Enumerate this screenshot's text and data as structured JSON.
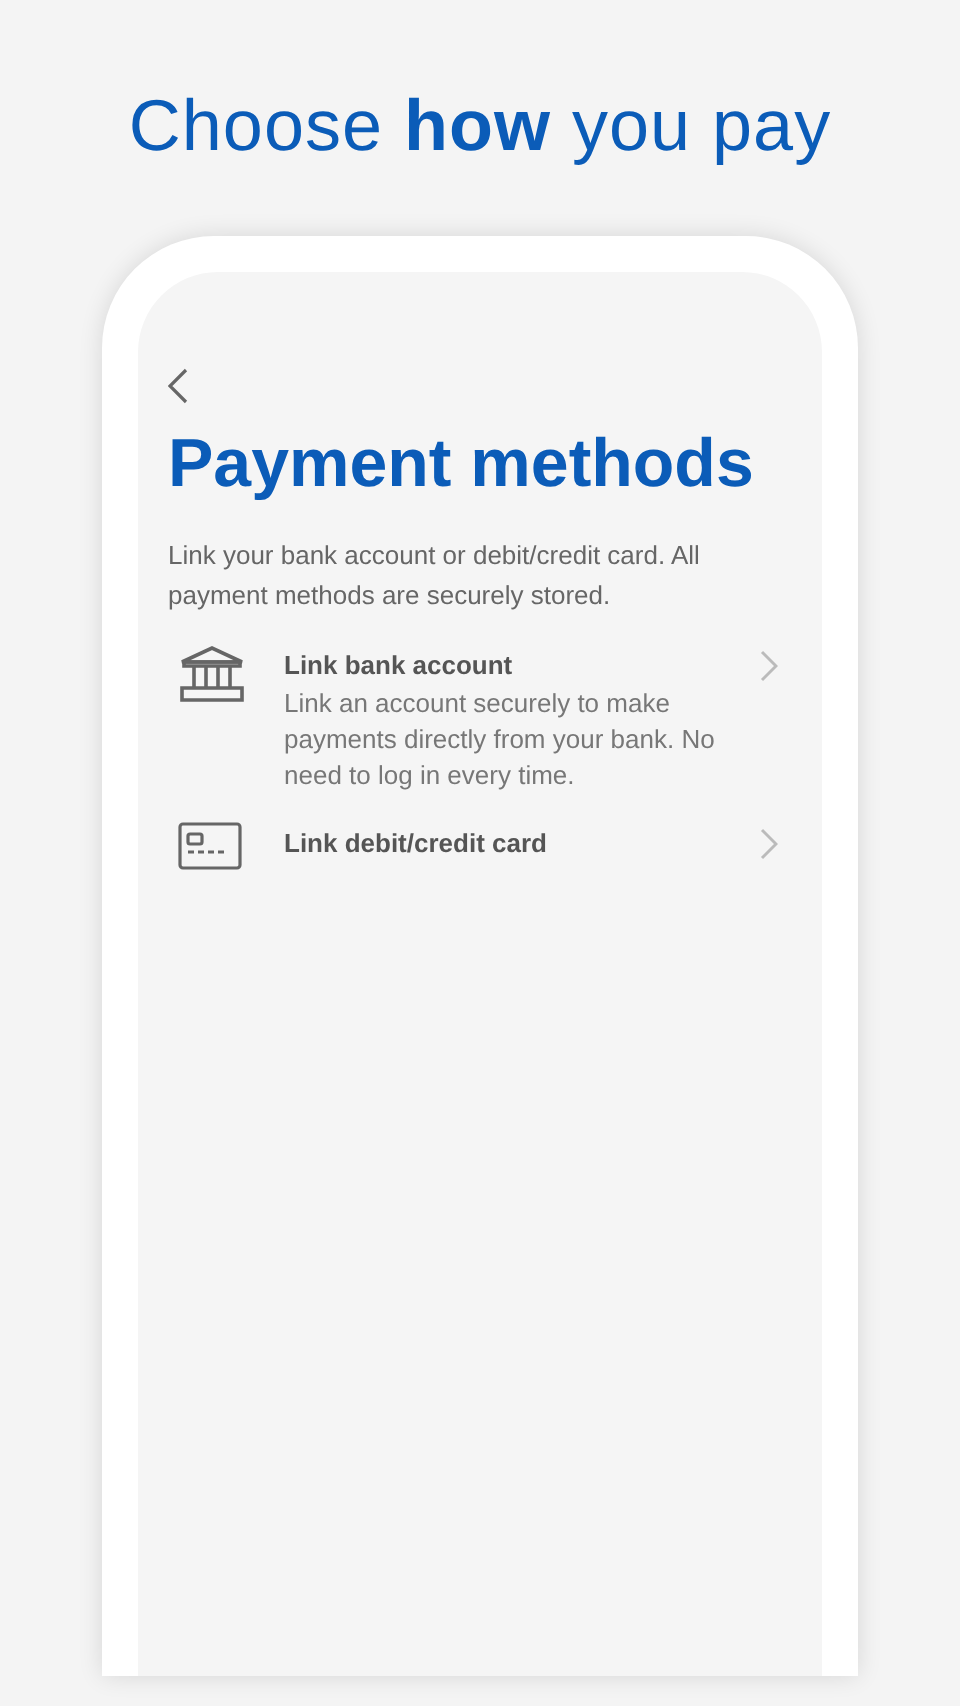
{
  "headline": "Choose **how** you pay",
  "screen": {
    "title": "Payment methods",
    "intro": "Link your bank account or debit/credit card. All payment methods are securely stored.",
    "methods": [
      {
        "kind": "bank",
        "label": "Link bank account",
        "description": "Link an account securely to make payments directly from your bank. No need to log in every time."
      },
      {
        "kind": "card",
        "label": "Link debit/credit card"
      }
    ]
  }
}
